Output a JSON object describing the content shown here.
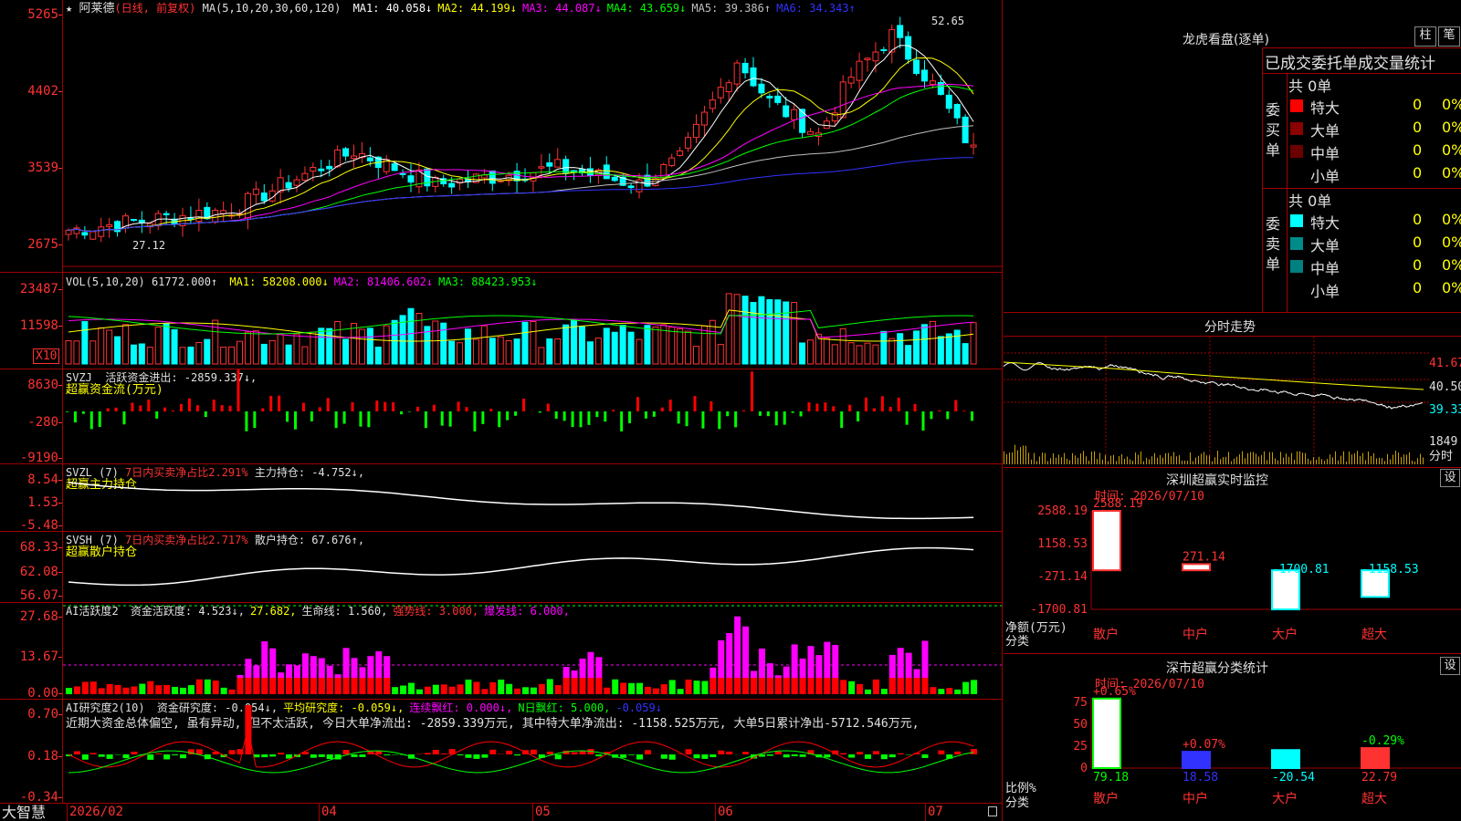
{
  "kline": {
    "star": "★",
    "stock_name": "阿莱德",
    "period": "(日线, 前复权)",
    "ma_label": "MA(5,10,20,30,60,120)",
    "ma_values": [
      {
        "name": "MA1:",
        "value": "40.058↓",
        "color": "#ffffff"
      },
      {
        "name": "MA2:",
        "value": "44.199↓",
        "color": "#ffff00"
      },
      {
        "name": "MA3:",
        "value": "44.087↓",
        "color": "#ff00ff"
      },
      {
        "name": "MA4:",
        "value": "43.659↓",
        "color": "#00ff00"
      },
      {
        "name": "MA5:",
        "value": "39.386↑",
        "color": "#c0c0c0"
      },
      {
        "name": "MA6:",
        "value": "34.343↑",
        "color": "#3232ff"
      }
    ],
    "y_ticks": [
      "5265",
      "4402",
      "3539",
      "2675"
    ],
    "high_label": "52.65",
    "low_label": "27.12"
  },
  "vol": {
    "label": "VOL(5,10,20)",
    "value": "61772.000↑",
    "ma": [
      {
        "name": "MA1:",
        "value": "58208.000↓",
        "color": "#ffff00"
      },
      {
        "name": "MA2:",
        "value": "81406.602↓",
        "color": "#ff00ff"
      },
      {
        "name": "MA3:",
        "value": "88423.953↓",
        "color": "#00ff00"
      }
    ],
    "y_ticks": [
      "23487",
      "11598"
    ],
    "unit": "X10"
  },
  "svzj": {
    "label": "SVZJ",
    "text": "活跃资金进出: -2859.337↓,",
    "sub": "超赢资金流(万元)",
    "y_ticks": [
      "8630",
      "-280",
      "-9190"
    ]
  },
  "svzl": {
    "label": "SVZL (7)",
    "text1": "7日内买卖净占比2.291%",
    "text2": "主力持仓: -4.752↓,",
    "sub": "超赢主力持仓",
    "y_ticks": [
      "8.54",
      "1.53",
      "-5.48"
    ]
  },
  "svsh": {
    "label": "SVSH (7)",
    "text1": "7日内买卖净占比2.717%",
    "text2": "散户持仓: 67.676↑,",
    "sub": "超赢散户持仓",
    "y_ticks": [
      "68.33",
      "62.08",
      "56.07"
    ]
  },
  "ai1": {
    "label": "AI活跃度2",
    "items": [
      {
        "text": "资金活跃度: 4.523↓,",
        "color": "#e0e0e0"
      },
      {
        "text": "27.682,",
        "color": "#ffff00"
      },
      {
        "text": "生命线: 1.560,",
        "color": "#e0e0e0"
      },
      {
        "text": "强势线: 3.000,",
        "color": "#ff3232"
      },
      {
        "text": "爆发线: 6.000,",
        "color": "#ff00ff"
      }
    ],
    "y_ticks": [
      "27.68",
      "13.67",
      "0.00"
    ]
  },
  "ai2": {
    "label": "AI研究度2(10)",
    "items": [
      {
        "text": "资金研究度: -0.054↓,",
        "color": "#e0e0e0"
      },
      {
        "text": "平均研究度: -0.059↓,",
        "color": "#ffff00"
      },
      {
        "text": "连续飘红: 0.000↓,",
        "color": "#ff00ff"
      },
      {
        "text": "N日飘红: 5.000,",
        "color": "#00ff00"
      },
      {
        "text": "-0.059↓",
        "color": "#3232ff"
      }
    ],
    "comment": "近期大资金总体偏空, 虽有异动, 但不太活跃, 今日大单净流出: -2859.339万元, 其中特大单净流出: -1158.525万元, 大单5日累计净出-5712.546万元,",
    "y_ticks": [
      "0.70",
      "0.18",
      "-0.34"
    ]
  },
  "footer": {
    "brand": "大智慧",
    "dates": [
      "2026/02",
      "04",
      "05",
      "06",
      "07"
    ]
  },
  "lhb": {
    "title": "龙虎看盘(逐单)",
    "buttons": [
      "柱",
      "笔"
    ],
    "header": "已成交委托单成交量统计",
    "buy_side": "委买单",
    "sell_side": "委卖单",
    "buy_total": "共 0单",
    "sell_total": "共 0单",
    "buy_rows": [
      {
        "name": "特大",
        "count": "0",
        "pct": "0%",
        "color": "#ff0000"
      },
      {
        "name": "大单",
        "count": "0",
        "pct": "0%",
        "color": "#8b0000"
      },
      {
        "name": "中单",
        "count": "0",
        "pct": "0%",
        "color": "#6b0000"
      },
      {
        "name": "小单",
        "count": "0",
        "pct": "0%",
        "color": "#000000"
      }
    ],
    "sell_rows": [
      {
        "name": "特大",
        "count": "0",
        "pct": "0%",
        "color": "#00ffff"
      },
      {
        "name": "大单",
        "count": "0",
        "pct": "0%",
        "color": "#008b8b"
      },
      {
        "name": "中单",
        "count": "0",
        "pct": "0%",
        "color": "#008080"
      },
      {
        "name": "小单",
        "count": "0",
        "pct": "0%",
        "color": "#000000"
      }
    ]
  },
  "fenshi": {
    "title": "分时走势",
    "y_ticks": [
      "41.67",
      "40.50",
      "39.33"
    ],
    "vol_tick": "1849",
    "vol_unit": "分时"
  },
  "monitor": {
    "title": "深圳超赢实时监控",
    "set": "设",
    "time": "时间: 2026/07/10",
    "y_ticks": [
      "2588.19",
      "1158.53",
      "-271.14",
      "-1700.81"
    ],
    "unit": "净额(万元)",
    "category_label": "分类",
    "bars": [
      {
        "category": "散户",
        "value": 2588.19,
        "label": "2588.19",
        "color": "#ff3232"
      },
      {
        "category": "中户",
        "value": 271.14,
        "label": "271.14",
        "color": "#ff3232"
      },
      {
        "category": "大户",
        "value": -1700.81,
        "label": "-1700.81",
        "color": "#00ffff"
      },
      {
        "category": "超大",
        "value": -1158.53,
        "label": "-1158.53",
        "color": "#00ffff"
      }
    ]
  },
  "classify": {
    "title": "深市超赢分类统计",
    "set": "设",
    "time": "时间: 2026/07/10",
    "y_ticks": [
      "75",
      "50",
      "25",
      "0"
    ],
    "unit": "比例%",
    "category_label": "分类",
    "bars": [
      {
        "category": "散户",
        "value": 79.18,
        "label": "79.18",
        "change": "+0.65%",
        "color": "#00ff00",
        "change_color": "#ff3232",
        "fill": "#ffffff"
      },
      {
        "category": "中户",
        "value": 18.58,
        "label": "18.58",
        "change": "+0.07%",
        "color": "#3232ff",
        "change_color": "#ff3232",
        "fill": "#3232ff"
      },
      {
        "category": "大户",
        "value": -20.54,
        "label": "-20.54",
        "change": "",
        "color": "#00ffff",
        "change_color": "#ff3232",
        "fill": "#00ffff"
      },
      {
        "category": "超大",
        "value": 22.79,
        "label": "22.79",
        "change": "-0.29%",
        "color": "#ff3232",
        "change_color": "#00ff00",
        "fill": "#ff3232"
      }
    ]
  }
}
